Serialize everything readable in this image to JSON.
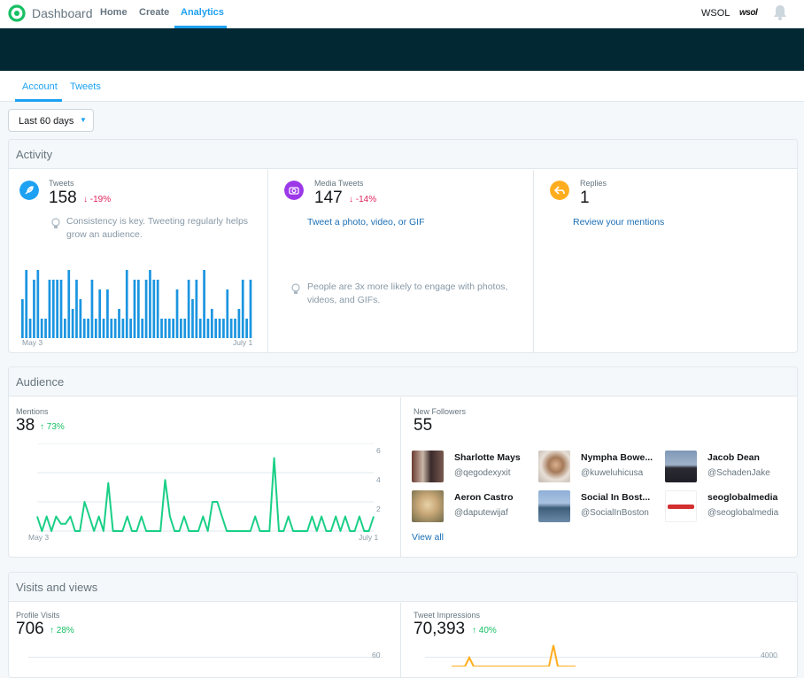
{
  "topnav": {
    "brand": "Dashboard",
    "links": [
      "Home",
      "Create",
      "Analytics"
    ],
    "account_name": "WSOL",
    "account_logo_text": "wsol"
  },
  "subnav": {
    "tabs": [
      "Account",
      "Tweets"
    ],
    "active": "Account"
  },
  "date_range": {
    "label": "Last 60 days"
  },
  "activity": {
    "title": "Activity",
    "tweets": {
      "label": "Tweets",
      "value": "158",
      "delta": "-19%",
      "tip": "Consistency is key. Tweeting regularly helps grow an audience.",
      "chart_start": "May 3",
      "chart_end": "July 1"
    },
    "media": {
      "label": "Media Tweets",
      "value": "147",
      "delta": "-14%",
      "link": "Tweet a photo, video, or GIF",
      "tip": "People are 3x more likely to engage with photos, videos, and GIFs."
    },
    "replies": {
      "label": "Replies",
      "value": "1",
      "link": "Review your mentions"
    }
  },
  "audience": {
    "title": "Audience",
    "mentions": {
      "label": "Mentions",
      "value": "38",
      "delta": "73%",
      "chart_start": "May 3",
      "chart_end": "July 1",
      "y_ticks": [
        "6",
        "4",
        "2"
      ]
    },
    "followers": {
      "label": "New Followers",
      "value": "55",
      "list": [
        {
          "name": "Sharlotte Mays",
          "handle": "@qegodexyxit"
        },
        {
          "name": "Nympha Bowe...",
          "handle": "@kuweluhicusa"
        },
        {
          "name": "Jacob Dean",
          "handle": "@SchadenJake"
        },
        {
          "name": "Aeron Castro",
          "handle": "@daputewijaf"
        },
        {
          "name": "Social In Bost...",
          "handle": "@SocialInBoston"
        },
        {
          "name": "seoglobalmedia",
          "handle": "@seoglobalmedia"
        }
      ],
      "view_all": "View all"
    }
  },
  "visits": {
    "title": "Visits and views",
    "profile": {
      "label": "Profile Visits",
      "value": "706",
      "delta": "28%",
      "y_tick": "60"
    },
    "impressions": {
      "label": "Tweet Impressions",
      "value": "70,393",
      "delta": "40%",
      "y_tick": "4000"
    }
  },
  "chart_data": [
    {
      "type": "bar",
      "title": "Tweets",
      "x_range": [
        "May 3",
        "July 1"
      ],
      "values": [
        4,
        7,
        2,
        6,
        7,
        2,
        2,
        6,
        6,
        6,
        6,
        2,
        7,
        3,
        6,
        4,
        2,
        2,
        6,
        2,
        5,
        2,
        5,
        2,
        2,
        3,
        2,
        7,
        2,
        6,
        6,
        2,
        6,
        7,
        6,
        6,
        2,
        2,
        2,
        2,
        5,
        2,
        2,
        6,
        4,
        6,
        2,
        7,
        2,
        3,
        2,
        2,
        2,
        5,
        2,
        2,
        3,
        6,
        2,
        6
      ],
      "ylim": [
        0,
        8
      ]
    },
    {
      "type": "line",
      "title": "Mentions",
      "x_range": [
        "May 3",
        "July 1"
      ],
      "y_ticks": [
        2,
        4,
        6
      ],
      "ylim": [
        0,
        6
      ],
      "values": [
        1,
        0,
        1,
        0,
        1,
        0.5,
        0.5,
        1,
        0,
        0,
        2,
        1,
        0,
        1,
        0,
        3.3,
        0,
        0,
        0,
        1,
        0,
        0,
        1,
        0,
        0,
        0,
        0,
        3.5,
        1,
        0,
        0,
        1,
        0,
        0,
        0,
        1,
        0,
        2,
        2,
        1,
        0,
        0,
        0,
        0,
        0,
        0,
        1,
        0,
        0,
        0,
        5,
        0,
        0,
        1,
        0,
        0,
        0,
        0,
        1,
        0,
        1,
        0,
        0,
        1,
        0,
        1,
        0,
        0,
        1,
        0,
        0,
        1
      ]
    }
  ]
}
